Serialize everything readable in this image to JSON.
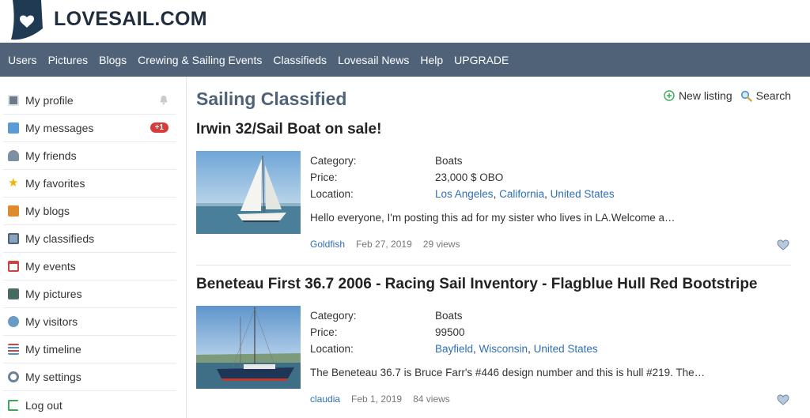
{
  "site": {
    "name": "LOVESAIL.COM"
  },
  "nav": [
    {
      "label": "Users"
    },
    {
      "label": "Pictures"
    },
    {
      "label": "Blogs"
    },
    {
      "label": "Crewing & Sailing Events"
    },
    {
      "label": "Classifieds"
    },
    {
      "label": "Lovesail News"
    },
    {
      "label": "Help"
    },
    {
      "label": "UPGRADE"
    }
  ],
  "sidebar": {
    "items": [
      {
        "label": "My profile",
        "icon": "profile-icon"
      },
      {
        "label": "My messages",
        "icon": "messages-icon",
        "badge": "+1"
      },
      {
        "label": "My friends",
        "icon": "friends-icon"
      },
      {
        "label": "My favorites",
        "icon": "star-icon"
      },
      {
        "label": "My blogs",
        "icon": "blogs-icon"
      },
      {
        "label": "My classifieds",
        "icon": "classifieds-icon"
      },
      {
        "label": "My events",
        "icon": "calendar-icon"
      },
      {
        "label": "My pictures",
        "icon": "pictures-icon"
      },
      {
        "label": "My visitors",
        "icon": "visitors-icon"
      },
      {
        "label": "My timeline",
        "icon": "timeline-icon"
      },
      {
        "label": "My settings",
        "icon": "settings-icon"
      },
      {
        "label": "Log out",
        "icon": "logout-icon"
      }
    ]
  },
  "main": {
    "title": "Sailing Classified",
    "actions": {
      "new_listing": "New listing",
      "search": "Search"
    },
    "labels": {
      "category": "Category:",
      "price": "Price:",
      "location": "Location:"
    },
    "listings": [
      {
        "title": "Irwin 32/Sail Boat on sale!",
        "category": "Boats",
        "price": "23,000 $ OBO",
        "location": {
          "city": "Los Angeles",
          "region": "California",
          "country": "United States"
        },
        "description": "Hello everyone, I'm posting this ad for my sister who lives in LA.Welcome a…",
        "author": "Goldfish",
        "date": "Feb 27, 2019",
        "views": "29 views"
      },
      {
        "title": "Beneteau First 36.7 2006 - Racing Sail Inventory - Flagblue Hull Red Bootstripe",
        "category": "Boats",
        "price": "99500",
        "location": {
          "city": "Bayfield",
          "region": "Wisconsin",
          "country": "United States"
        },
        "description": "The Beneteau 36.7 is Bruce Farr's #446 design number and this is hull #219. The…",
        "author": "claudia",
        "date": "Feb 1, 2019",
        "views": "84 views"
      }
    ]
  },
  "colors": {
    "nav_bg": "#4f6278",
    "link": "#2f6fb5",
    "badge": "#d93b3b",
    "title": "#4f6278"
  }
}
